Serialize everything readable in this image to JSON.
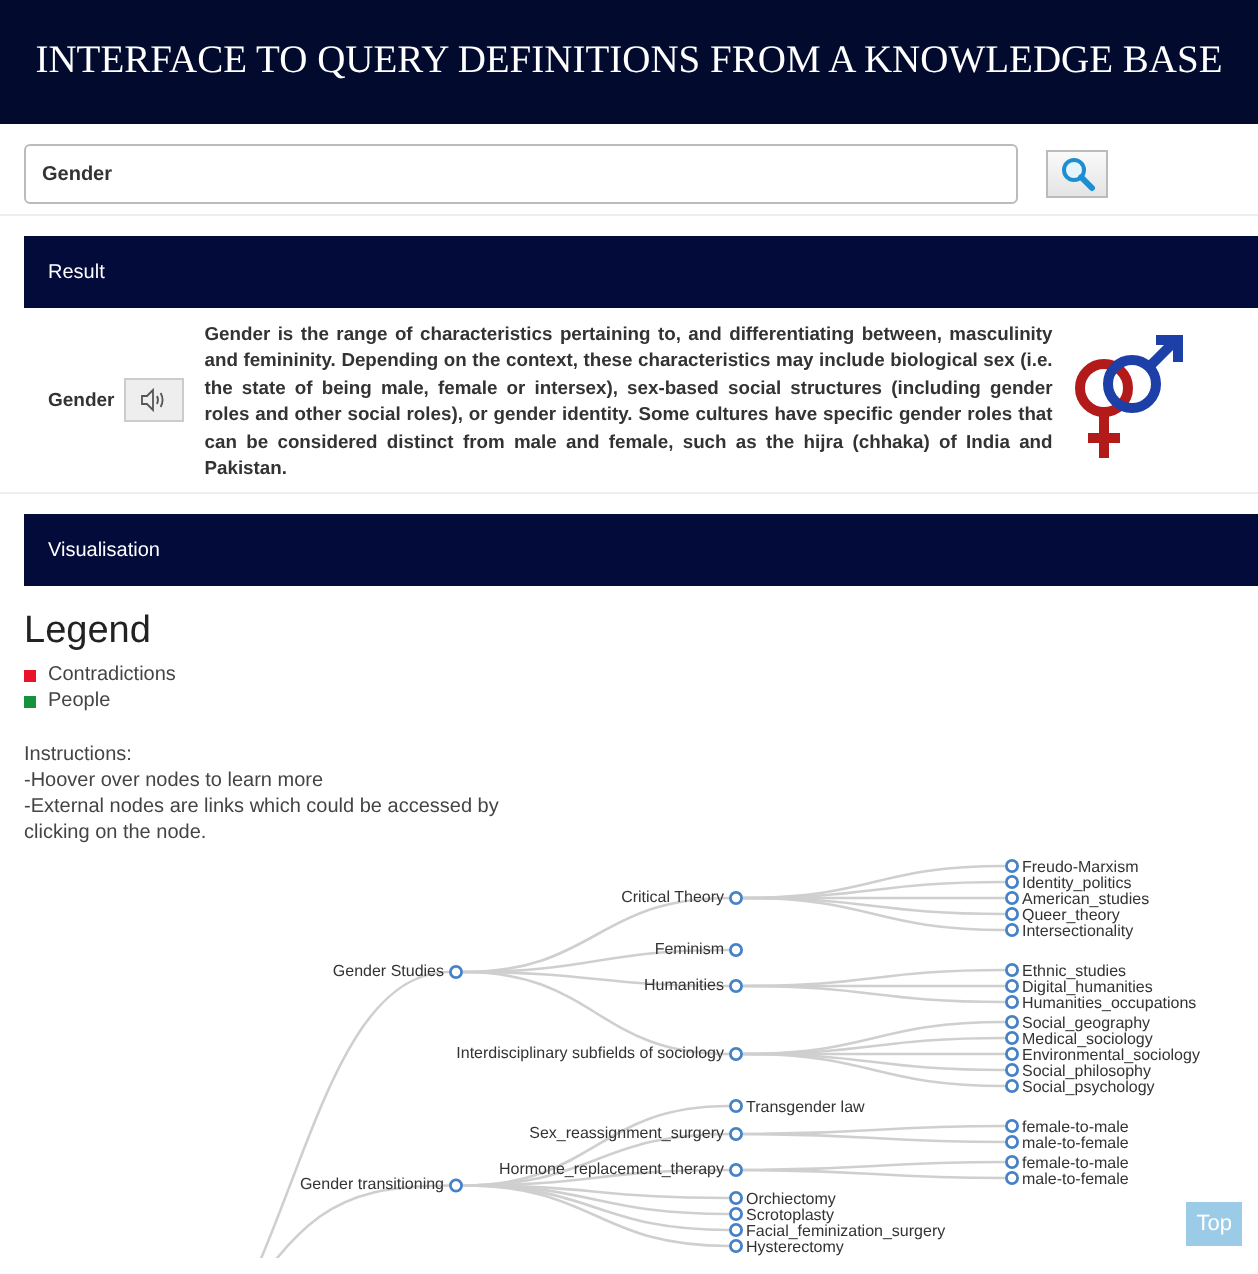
{
  "header": {
    "title": "INTERFACE TO QUERY DEFINITIONS FROM A KNOWLEDGE BASE"
  },
  "search": {
    "value": "Gender"
  },
  "result": {
    "heading": "Result",
    "term": "Gender",
    "definition": "Gender is the range of characteristics pertaining to, and differentiating between, masculinity and femininity. Depending on the context, these characteristics may include biological sex (i.e. the state of being male, female or intersex), sex-based social structures (including gender roles and other social roles), or gender identity. Some cultures have specific gender roles that can be considered distinct from male and female, such as the hijra (chhaka) of India and Pakistan."
  },
  "visualisation": {
    "heading": "Visualisation",
    "legend": {
      "title": "Legend",
      "items": [
        {
          "label": "Contradictions",
          "color": "#e8132b"
        },
        {
          "label": "People",
          "color": "#14923c"
        }
      ]
    },
    "instructions": [
      "Instructions:",
      "-Hoover over nodes to learn more",
      "-External nodes are links which could be accessed by clicking on the node."
    ],
    "tree": [
      {
        "label": "Gender Studies",
        "kind": "branch",
        "children": [
          {
            "label": "Critical Theory",
            "kind": "branch",
            "children": [
              {
                "label": "Freudo-Marxism",
                "kind": "leaf"
              },
              {
                "label": "Identity_politics",
                "kind": "leaf"
              },
              {
                "label": "American_studies",
                "kind": "leaf"
              },
              {
                "label": "Queer_theory",
                "kind": "leaf"
              },
              {
                "label": "Intersectionality",
                "kind": "leaf"
              }
            ]
          },
          {
            "label": "Feminism",
            "kind": "branch"
          },
          {
            "label": "Humanities",
            "kind": "branch",
            "children": [
              {
                "label": "Ethnic_studies",
                "kind": "leaf"
              },
              {
                "label": "Digital_humanities",
                "kind": "leaf"
              },
              {
                "label": "Humanities_occupations",
                "kind": "leaf"
              }
            ]
          },
          {
            "label": "Interdisciplinary subfields of sociology",
            "kind": "branch",
            "children": [
              {
                "label": "Social_geography",
                "kind": "leaf"
              },
              {
                "label": "Medical_sociology",
                "kind": "leaf"
              },
              {
                "label": "Environmental_sociology",
                "kind": "leaf"
              },
              {
                "label": "Social_philosophy",
                "kind": "leaf"
              },
              {
                "label": "Social_psychology",
                "kind": "leaf"
              }
            ]
          }
        ]
      },
      {
        "label": "Gender transitioning",
        "kind": "branch",
        "children": [
          {
            "label": "Transgender law",
            "kind": "leaf"
          },
          {
            "label": "Sex_reassignment_surgery",
            "kind": "branch",
            "children": [
              {
                "label": "female-to-male",
                "kind": "leaf"
              },
              {
                "label": "male-to-female",
                "kind": "leaf"
              }
            ]
          },
          {
            "label": "Hormone_replacement_therapy",
            "kind": "branch",
            "children": [
              {
                "label": "female-to-male",
                "kind": "leaf"
              },
              {
                "label": "male-to-female",
                "kind": "leaf"
              }
            ]
          },
          {
            "label": "Orchiectomy",
            "kind": "leaf"
          },
          {
            "label": "Scrotoplasty",
            "kind": "leaf"
          },
          {
            "label": "Facial_feminization_surgery",
            "kind": "leaf"
          },
          {
            "label": "Hysterectomy",
            "kind": "leaf"
          }
        ]
      }
    ]
  },
  "top_button": "Top"
}
